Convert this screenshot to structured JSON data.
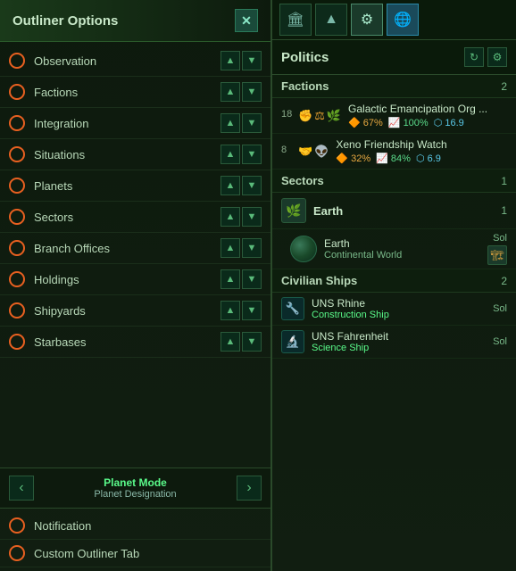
{
  "left": {
    "title": "Outliner Options",
    "close_label": "✕",
    "items": [
      {
        "id": "observation",
        "label": "Observation"
      },
      {
        "id": "factions",
        "label": "Factions"
      },
      {
        "id": "integration",
        "label": "Integration"
      },
      {
        "id": "situations",
        "label": "Situations"
      },
      {
        "id": "planets",
        "label": "Planets"
      },
      {
        "id": "sectors",
        "label": "Sectors"
      },
      {
        "id": "branch-offices",
        "label": "Branch Offices"
      },
      {
        "id": "holdings",
        "label": "Holdings"
      },
      {
        "id": "shipyards",
        "label": "Shipyards"
      },
      {
        "id": "starbases",
        "label": "Starbases"
      }
    ],
    "planet_mode": {
      "title": "Planet Mode",
      "sub": "Planet Designation"
    },
    "bottom_items": [
      {
        "id": "notification",
        "label": "Notification"
      },
      {
        "id": "custom-outliner",
        "label": "Custom Outliner Tab"
      }
    ]
  },
  "right": {
    "header_icons": [
      "🏛",
      "🚀",
      "⚙",
      "🌐"
    ],
    "politics_title": "Politics",
    "refresh_icon": "↻",
    "settings_icon": "⚙",
    "sections": {
      "factions": {
        "title": "Factions",
        "count": 2,
        "items": [
          {
            "num": 18,
            "name": "Galactic Emancipation Org ...",
            "approval": "67%",
            "support": "100%",
            "influence": "16.9"
          },
          {
            "num": 8,
            "name": "Xeno Friendship Watch",
            "approval": "32%",
            "support": "84%",
            "influence": "6.9"
          }
        ]
      },
      "sectors": {
        "title": "Sectors",
        "count": 1,
        "items": [
          {
            "name": "Earth",
            "count": 1,
            "planets": [
              {
                "name": "Earth",
                "type": "Continental World",
                "location": "Sol"
              }
            ]
          }
        ]
      },
      "civilian_ships": {
        "title": "Civilian Ships",
        "count": 2,
        "items": [
          {
            "name": "UNS Rhine",
            "type": "Construction Ship",
            "location": "Sol"
          },
          {
            "name": "UNS Fahrenheit",
            "type": "Science Ship",
            "location": "Sol"
          }
        ]
      }
    }
  }
}
